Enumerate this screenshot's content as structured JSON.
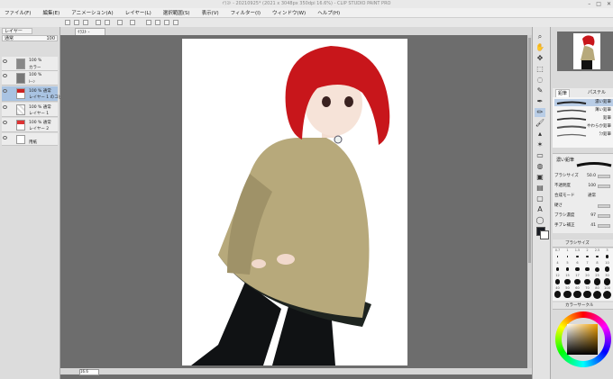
{
  "window": {
    "title": "ｲﾗｽﾄ - 20210925*  (2021 x 3048px 350dpi 16.6%)  - CLIP STUDIO PAINT PRO",
    "controls": [
      "–",
      "□",
      "✕"
    ]
  },
  "menu": [
    "ファイル(F)",
    "編集(E)",
    "アニメーション(A)",
    "レイヤー(L)",
    "選択範囲(S)",
    "表示(V)",
    "フィルター(I)",
    "ウィンドウ(W)",
    "ヘルプ(H)"
  ],
  "canvas": {
    "tab_label": "ｲﾗｽﾄ - 20210925*",
    "zoom": "16.6",
    "background_color": "#6d6d6d"
  },
  "layers": {
    "tab_label": "レイヤー",
    "blend_mode": "通常",
    "opacity": "100",
    "items": [
      {
        "percent": "100 %",
        "name": "カラー",
        "selected": false
      },
      {
        "percent": "100 %",
        "name": "ﾄｰﾝ",
        "selected": false
      },
      {
        "percent": "100 % 通常",
        "name": "レイヤー 1 のコピー",
        "selected": true
      },
      {
        "percent": "100 % 通常",
        "name": "レイヤー 1",
        "selected": false
      },
      {
        "percent": "100 % 通常",
        "name": "レイヤー 2",
        "selected": false
      },
      {
        "percent": "",
        "name": "用紙",
        "selected": false
      }
    ]
  },
  "brush_panel": {
    "tabs": [
      "鉛筆",
      "パステル"
    ],
    "items": [
      "濃い鉛筆",
      "薄い鉛筆",
      "鉛筆",
      "やわらか鉛筆",
      "ﾗﾌ鉛筆"
    ],
    "selected_index": 0
  },
  "tool_property": {
    "title": "濃い鉛筆",
    "rows": [
      {
        "label": "ブラシサイズ",
        "value": "50.0"
      },
      {
        "label": "不透明度",
        "value": "100"
      },
      {
        "label": "合成モード",
        "value": "通常"
      },
      {
        "label": "硬さ",
        "value": ""
      },
      {
        "label": "ブラシ濃度",
        "value": "97"
      },
      {
        "label": "手ブレ補正",
        "value": "41"
      }
    ]
  },
  "brush_size_panel": {
    "title": "ブラシサイズ",
    "sizes": [
      "0.7",
      "1",
      "1.5",
      "2",
      "2.5",
      "3",
      "4",
      "5",
      "6",
      "7",
      "8",
      "10",
      "12",
      "15",
      "17",
      "20",
      "25",
      "30",
      "40",
      "50",
      "60",
      "70",
      "80",
      "100"
    ]
  },
  "color_panel": {
    "title": "カラーサークル",
    "main_color": "#1a1d24",
    "sub_color": "#ffffff"
  }
}
